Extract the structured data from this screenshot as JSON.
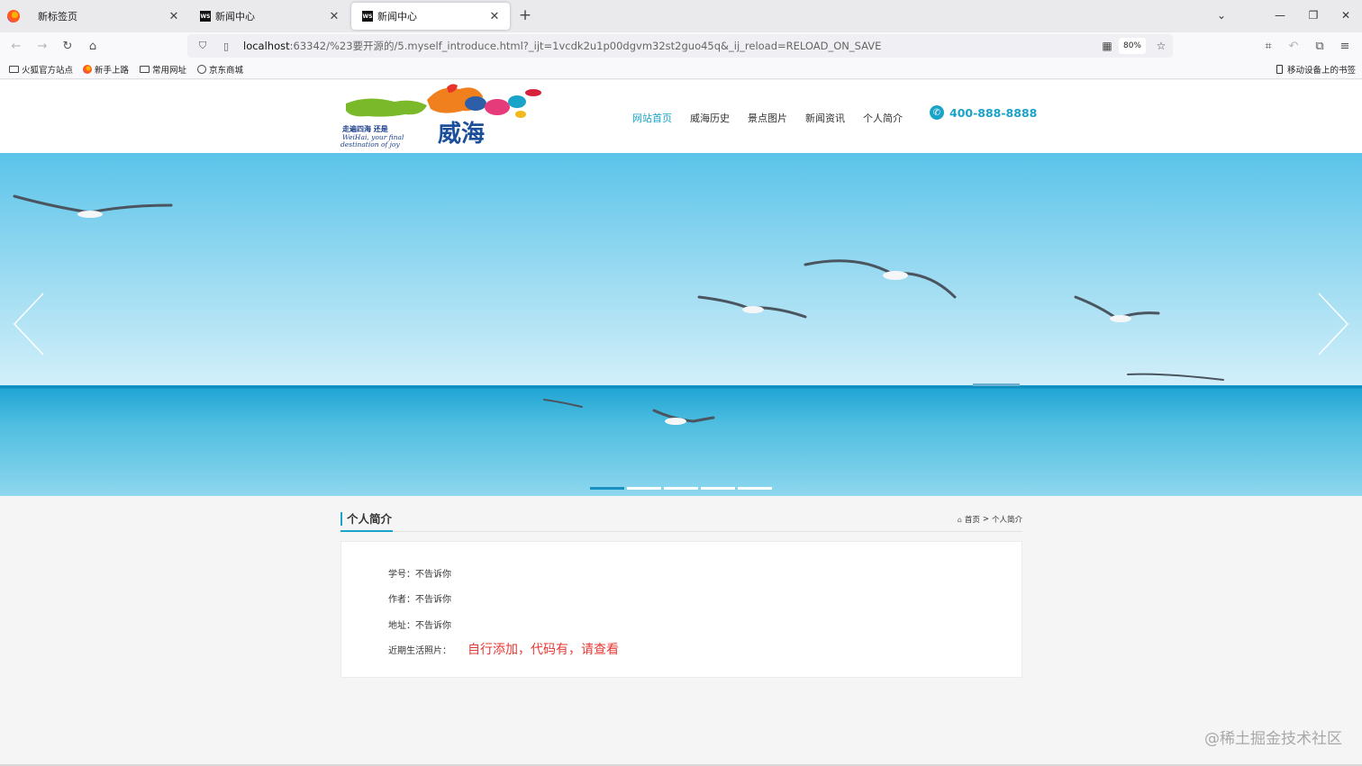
{
  "browser": {
    "tabs": [
      {
        "title": "新标签页",
        "active": false
      },
      {
        "title": "新闻中心",
        "active": false
      },
      {
        "title": "新闻中心",
        "active": true
      }
    ],
    "tab_icon_text": "WS",
    "url": {
      "host": "localhost",
      "rest": ":63342/%23要开源的/5.myself_introduce.html?_ijt=1vcdk2u1p00dgvm32st2guo45q&_ij_reload=RELOAD_ON_SAVE"
    },
    "zoom": "80%",
    "bookmarks": [
      "火狐官方站点",
      "新手上路",
      "常用网址",
      "京东商城"
    ],
    "mobile_bookmarks": "移动设备上的书签"
  },
  "site": {
    "logo": {
      "cn_small": "走遍四海 还是",
      "cn_big": "威海",
      "en_line1": "WeiHai, your final",
      "en_line2": "destination of joy"
    },
    "nav": [
      {
        "label": "网站首页",
        "active": true
      },
      {
        "label": "威海历史",
        "active": false
      },
      {
        "label": "景点图片",
        "active": false
      },
      {
        "label": "新闻资讯",
        "active": false
      },
      {
        "label": "个人简介",
        "active": false
      }
    ],
    "phone": "400-888-8888",
    "banner": {
      "slide_count": 5,
      "active_slide": 0
    },
    "section": {
      "title": "个人简介",
      "breadcrumb_home": "首页",
      "breadcrumb_sep": ">",
      "breadcrumb_current": "个人简介"
    },
    "info": {
      "student_id": "学号：不告诉你",
      "author": "作者：不告诉你",
      "address": "地址：不告诉你",
      "photos_label": "近期生活照片：",
      "photos_note": "自行添加，代码有，请查看"
    }
  },
  "watermark": "@稀土掘金技术社区",
  "colors": {
    "accent": "#1aa3c8",
    "note_red": "#e53935",
    "dot_active": "#1a90c0"
  }
}
